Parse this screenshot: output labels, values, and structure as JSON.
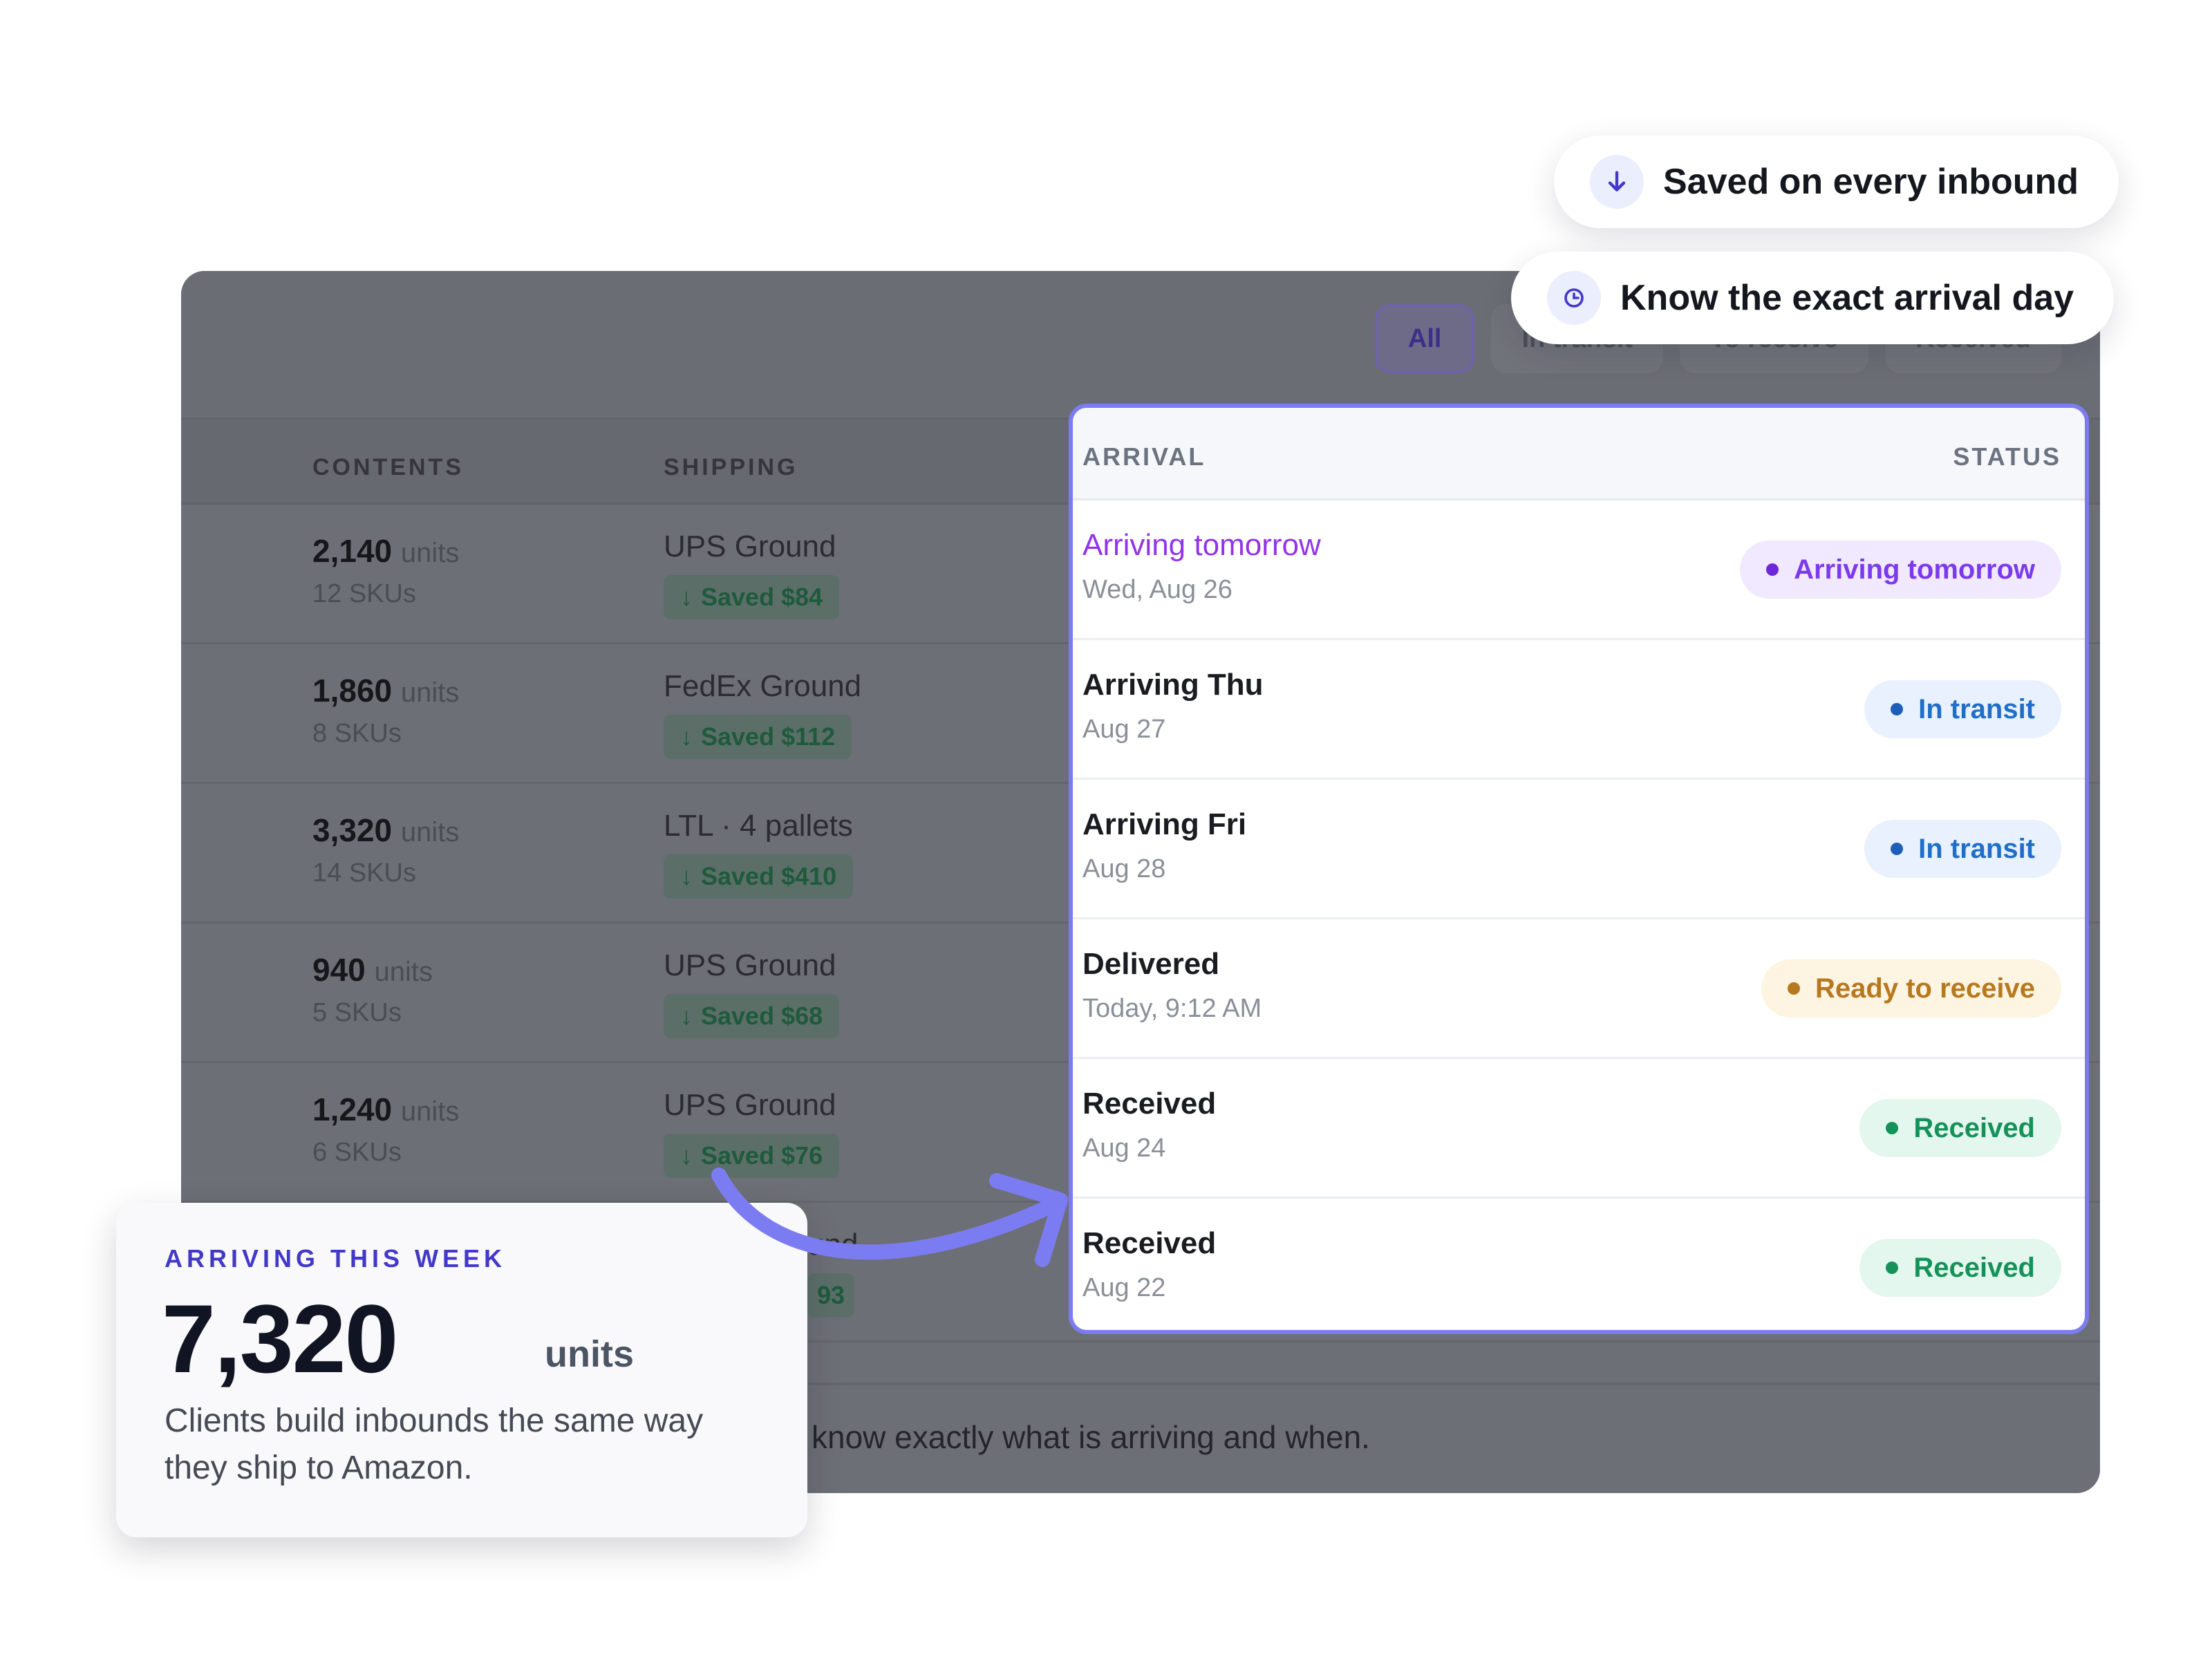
{
  "filters": [
    "All",
    "In transit",
    "To receive",
    "Received"
  ],
  "table": {
    "headers": {
      "contents": "CONTENTS",
      "shipping": "SHIPPING",
      "arrival": "ARRIVAL",
      "status": "STATUS"
    },
    "rows": [
      {
        "units": "2,140",
        "units_label": "units",
        "skus": "12 SKUs",
        "carrier": "UPS Ground",
        "saved": "Saved $84",
        "arrival_title": "Arriving tomorrow",
        "arrival_date": "Wed, Aug 26",
        "status": "Arriving tomorrow"
      },
      {
        "units": "1,860",
        "units_label": "units",
        "skus": "8 SKUs",
        "carrier": "FedEx Ground",
        "saved": "Saved $112",
        "arrival_title": "Arriving Thu",
        "arrival_date": "Aug 27",
        "status": "In transit"
      },
      {
        "units": "3,320",
        "units_label": "units",
        "skus": "14 SKUs",
        "carrier": "LTL · 4 pallets",
        "saved": "Saved $410",
        "arrival_title": "Arriving Fri",
        "arrival_date": "Aug 28",
        "status": "In transit"
      },
      {
        "units": "940",
        "units_label": "units",
        "skus": "5 SKUs",
        "carrier": "UPS Ground",
        "saved": "Saved $68",
        "arrival_title": "Delivered",
        "arrival_date": "Today, 9:12 AM",
        "status": "Ready to receive"
      },
      {
        "units": "1,240",
        "units_label": "units",
        "skus": "6 SKUs",
        "carrier": "UPS Ground",
        "saved": "Saved $76",
        "arrival_title": "Received",
        "arrival_date": "Aug 24",
        "status": "Received"
      },
      {
        "units": "",
        "units_label": "",
        "skus": "",
        "carrier": "und",
        "saved": "93",
        "arrival_title": "Received",
        "arrival_date": "Aug 22",
        "status": "Received"
      }
    ]
  },
  "footer_text": "know exactly what is arriving and when.",
  "badges": {
    "saved": "Saved on every inbound",
    "arrival": "Know the exact arrival day",
    "saved_icon": "arrow-down-icon",
    "arrival_icon": "clock-icon"
  },
  "summary": {
    "eyebrow": "ARRIVING THIS WEEK",
    "total": "7,320",
    "unit": "units",
    "description": "Clients build inbounds the same way they ship to Amazon."
  },
  "colors": {
    "accent": "#4338ca",
    "highlight_border": "#7c7cf2",
    "arriving": "#9333ea",
    "in_transit": "#1f6fc9",
    "ready": "#b7791f",
    "received": "#15925a"
  }
}
